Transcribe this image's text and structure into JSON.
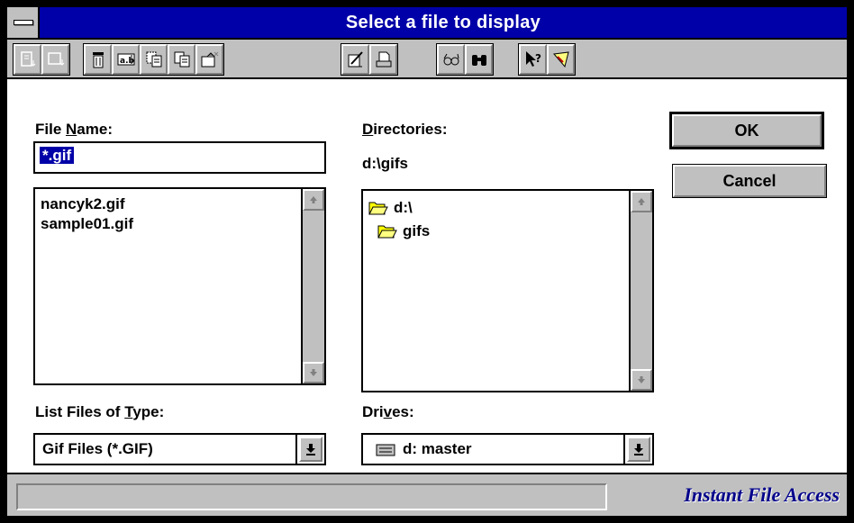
{
  "window": {
    "title": "Select a file to display"
  },
  "toolbar": {
    "groups": [
      [
        "open-icon",
        "view-icon"
      ],
      [
        "delete-icon",
        "rename-icon",
        "copy-icon",
        "paste-icon",
        "move-icon"
      ],
      [
        "edit-icon",
        "print-icon"
      ],
      [
        "find-icon",
        "search-icon"
      ],
      [
        "help-icon",
        "about-icon"
      ]
    ]
  },
  "file_name": {
    "label_pre": "File ",
    "label_accel": "N",
    "label_post": "ame:",
    "value": "*.gif"
  },
  "files": {
    "items": [
      "nancyk2.gif",
      "sample01.gif"
    ]
  },
  "directories": {
    "label_accel": "D",
    "label_post": "irectories:",
    "current_path": "d:\\gifs",
    "items": [
      {
        "label": "d:\\",
        "icon": "open-folder-icon"
      },
      {
        "label": "gifs",
        "icon": "open-folder-icon"
      }
    ]
  },
  "file_type": {
    "label_pre": "List Files of ",
    "label_accel": "T",
    "label_post": "ype:",
    "value": "Gif Files (*.GIF)"
  },
  "drives": {
    "label_pre": "Dri",
    "label_accel": "v",
    "label_post": "es:",
    "value": "d: master"
  },
  "buttons": {
    "ok": "OK",
    "cancel": "Cancel"
  },
  "statusbar": {
    "text": "",
    "brand": "Instant File Access"
  },
  "colors": {
    "titlebar": "#0000a8",
    "face": "#c0c0c0",
    "selection": "#0000a8",
    "brand": "#00008b"
  }
}
